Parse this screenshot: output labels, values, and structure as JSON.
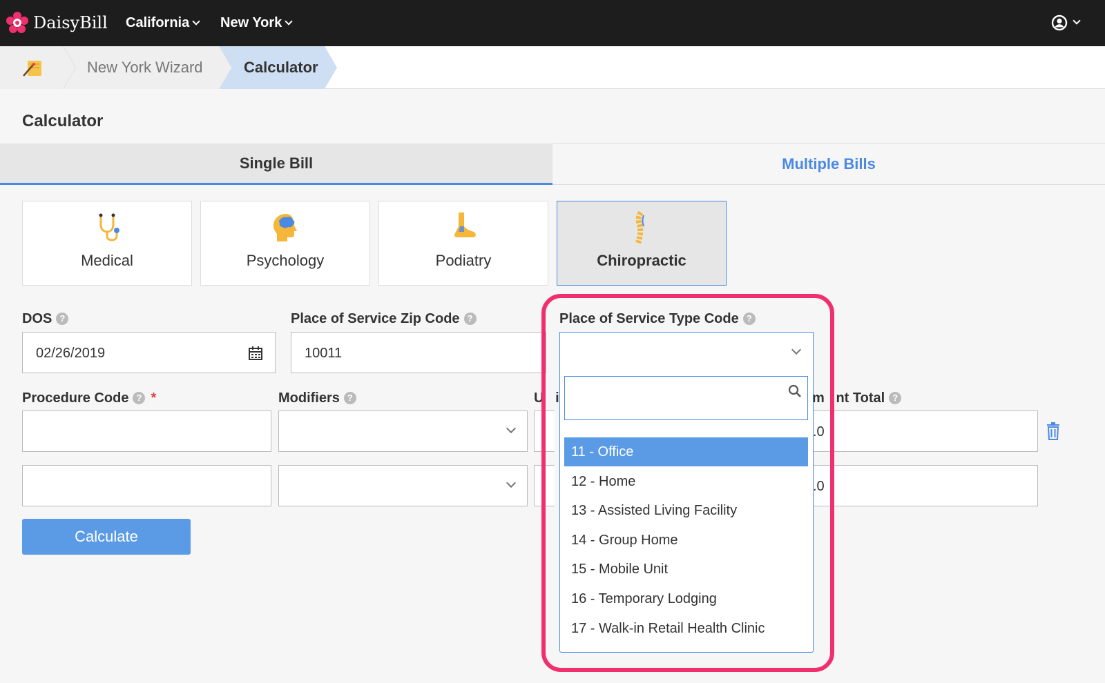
{
  "header": {
    "brand": "DaisyBill",
    "nav": [
      "California",
      "New York"
    ]
  },
  "breadcrumb": {
    "items": [
      "New York Wizard",
      "Calculator"
    ]
  },
  "page": {
    "title": "Calculator"
  },
  "tabs": {
    "single": "Single Bill",
    "multiple": "Multiple Bills"
  },
  "specialties": [
    "Medical",
    "Psychology",
    "Podiatry",
    "Chiropractic"
  ],
  "form": {
    "dos_label": "DOS",
    "dos_value": "02/26/2019",
    "zip_label": "Place of Service Zip Code",
    "zip_value": "10011",
    "type_label": "Place of Service Type Code",
    "procedure_label": "Procedure Code",
    "required_mark": "*",
    "modifiers_label": "Modifiers",
    "units_label_partial": "U   i",
    "units_row1": ".0",
    "units_row2": ".0",
    "total_label_partial": "m   nt Total",
    "help_glyph": "?",
    "calculate_label": "Calculate"
  },
  "dropdown": {
    "options": [
      "11 - Office",
      "12 - Home",
      "13 - Assisted Living Facility",
      "14 - Group Home",
      "15 - Mobile Unit",
      "16 - Temporary Lodging",
      "17 - Walk-in Retail Health Clinic"
    ],
    "active_index": 0
  },
  "colors": {
    "accent": "#4a89e4",
    "button": "#5b9be6",
    "highlight": "#f0306e",
    "topbar": "#1d1d1d"
  }
}
